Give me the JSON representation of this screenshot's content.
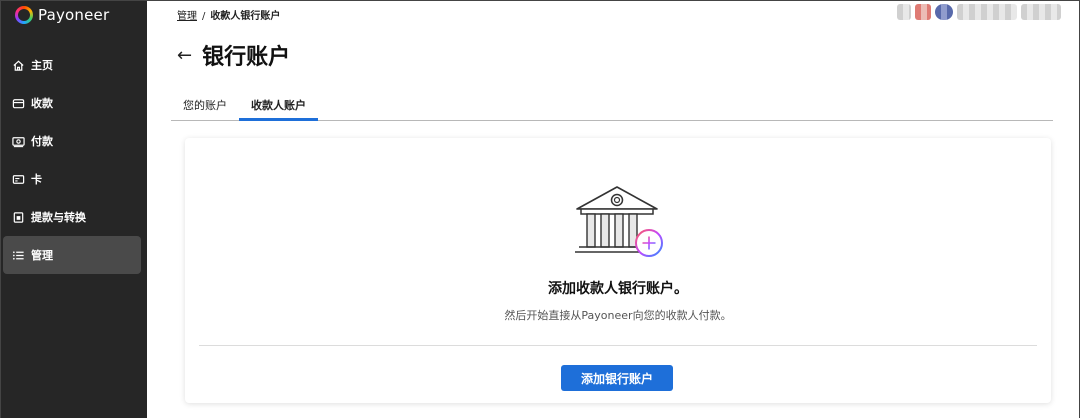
{
  "brand": {
    "name": "Payoneer"
  },
  "sidebar": {
    "items": [
      {
        "label": "主页",
        "icon": "home-icon"
      },
      {
        "label": "收款",
        "icon": "receive-icon"
      },
      {
        "label": "付款",
        "icon": "payment-icon"
      },
      {
        "label": "卡",
        "icon": "card-icon"
      },
      {
        "label": "提款与转换",
        "icon": "withdraw-icon"
      },
      {
        "label": "管理",
        "icon": "list-icon",
        "active": true
      }
    ]
  },
  "breadcrumb": {
    "parent": "管理",
    "separator": "/",
    "current": "收款人银行账户"
  },
  "page": {
    "title": "银行账户"
  },
  "tabs": [
    {
      "label": "您的账户"
    },
    {
      "label": "收款人账户",
      "active": true
    }
  ],
  "card": {
    "title": "添加收款人银行账户。",
    "subtitle": "然后开始直接从Payoneer向您的收款人付款。",
    "button_label": "添加银行账户"
  },
  "colors": {
    "accent": "#1e6fd9",
    "sidebar_bg": "#262626"
  }
}
